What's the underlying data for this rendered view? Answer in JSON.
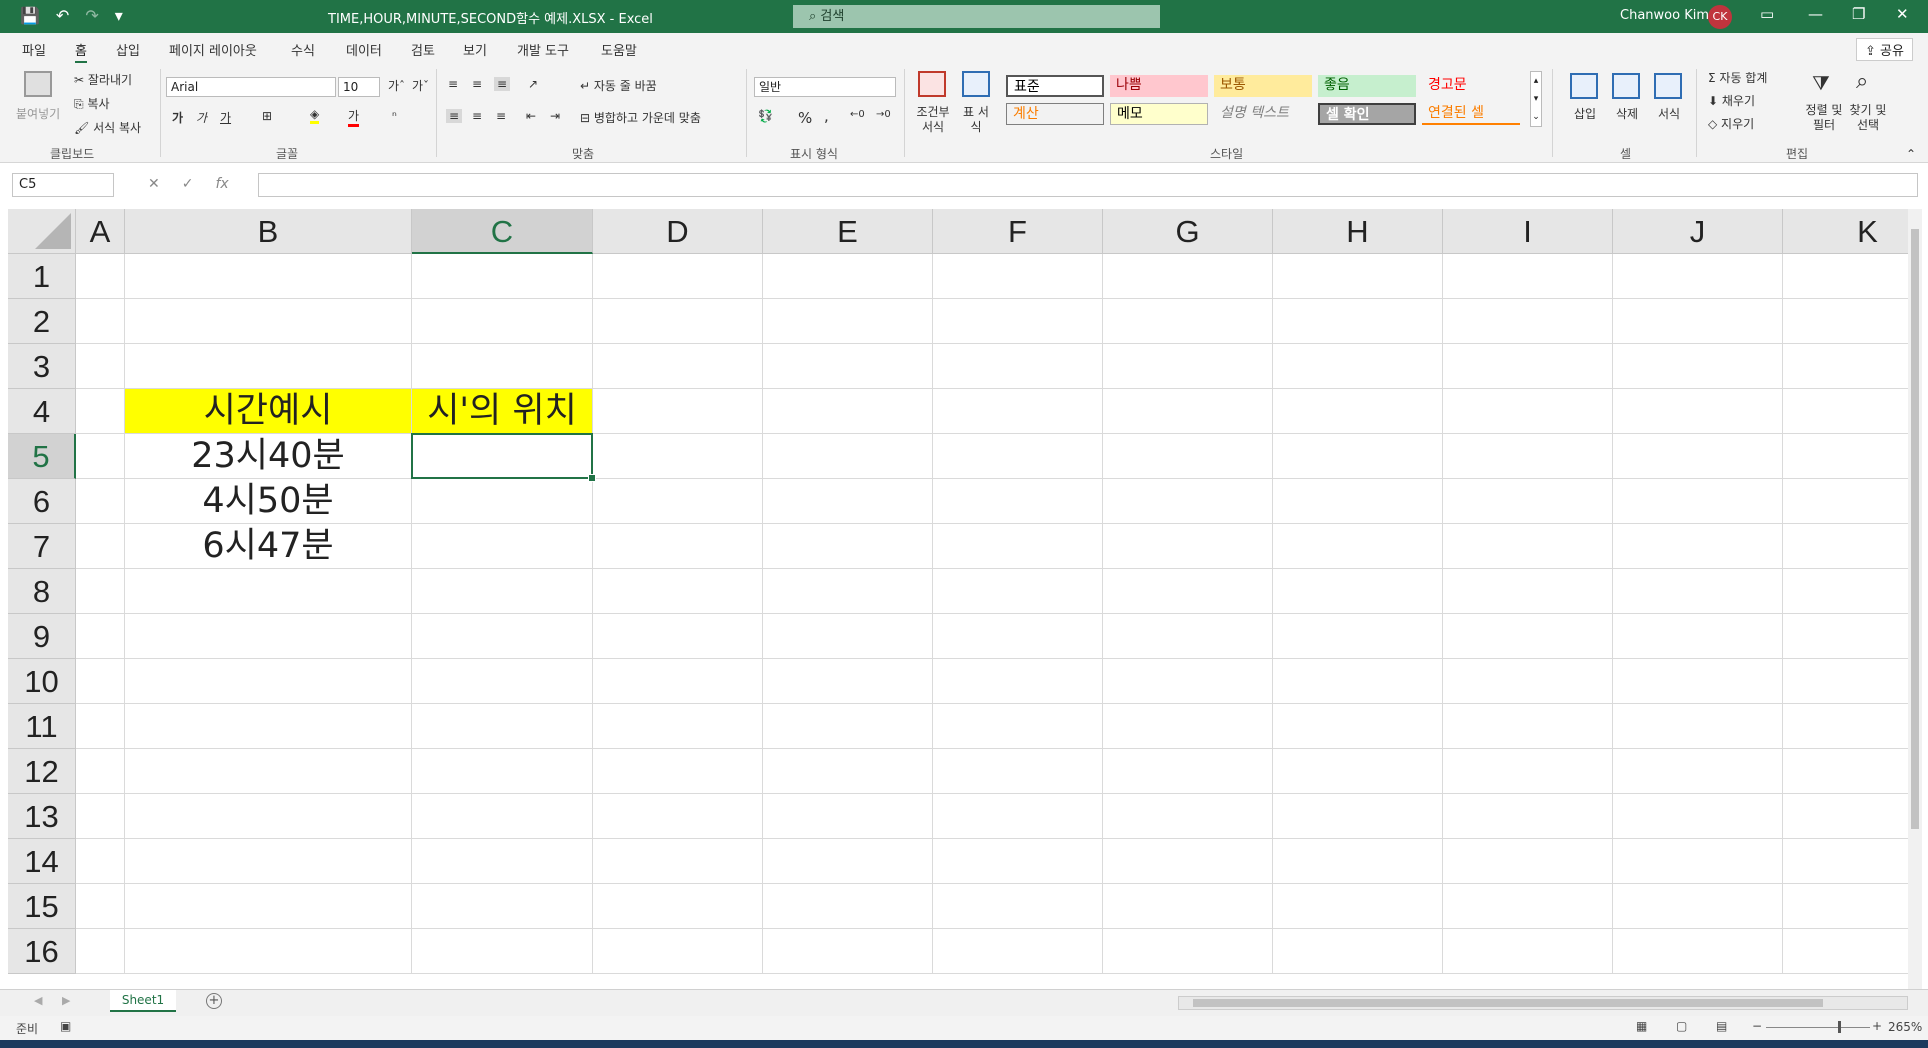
{
  "titlebar": {
    "doc_title": "TIME,HOUR,MINUTE,SECOND함수 예제.XLSX  -  Excel",
    "search_placeholder": "검색",
    "user_name": "Chanwoo Kim",
    "user_initials": "CK",
    "save_icon": "save-icon",
    "undo_icon": "undo-icon",
    "redo_icon": "redo-icon"
  },
  "menu": {
    "tabs": [
      "파일",
      "홈",
      "삽입",
      "페이지 레이아웃",
      "수식",
      "데이터",
      "검토",
      "보기",
      "개발 도구",
      "도움말"
    ],
    "active_tab": "홈",
    "share_label": "공유"
  },
  "ribbon": {
    "clipboard": {
      "paste": "붙여넣기",
      "cut": "잘라내기",
      "copy": "복사",
      "format_painter": "서식 복사",
      "label": "클립보드"
    },
    "font": {
      "family": "Arial",
      "size": "10",
      "bold": "가",
      "italic": "가",
      "underline": "가",
      "label": "글꼴"
    },
    "alignment": {
      "wrap": "자동 줄 바꿈",
      "merge": "병합하고 가운데 맞춤",
      "label": "맞춤"
    },
    "number": {
      "format": "일반",
      "percent": "%",
      "comma": ",",
      "label": "표시 형식"
    },
    "styles": {
      "conditional": "조건부 서식",
      "table": "표 서식",
      "cells": [
        {
          "name": "표준",
          "bg": "#ffffff",
          "fg": "#000000"
        },
        {
          "name": "나쁨",
          "bg": "#ffc7ce",
          "fg": "#9c0006"
        },
        {
          "name": "보통",
          "bg": "#ffeb9c",
          "fg": "#9c5700"
        },
        {
          "name": "좋음",
          "bg": "#c6efce",
          "fg": "#006100"
        },
        {
          "name": "경고문",
          "bg": "#f3f3f3",
          "fg": "#ff0000"
        },
        {
          "name": "계산",
          "bg": "#f2f2f2",
          "fg": "#fa7d00"
        },
        {
          "name": "메모",
          "bg": "#ffffcc",
          "fg": "#000000"
        },
        {
          "name": "설명 텍스트",
          "bg": "#f3f3f3",
          "fg": "#7f7f7f"
        },
        {
          "name": "셀 확인",
          "bg": "#a5a5a5",
          "fg": "#ffffff"
        },
        {
          "name": "연결된 셀",
          "bg": "#f3f3f3",
          "fg": "#fa7d00"
        }
      ],
      "label": "스타일"
    },
    "cells_group": {
      "insert": "삽입",
      "delete": "삭제",
      "format": "서식",
      "label": "셀"
    },
    "editing": {
      "autosum": "자동 합계",
      "fill": "채우기",
      "clear": "지우기",
      "sort_filter": "정렬 및 필터",
      "find_select": "찾기 및 선택",
      "label": "편집"
    }
  },
  "formula_bar": {
    "name_box": "C5",
    "cancel": "✕",
    "enter": "✓",
    "fx": "fx",
    "formula": ""
  },
  "grid": {
    "columns": [
      "A",
      "B",
      "C",
      "D",
      "E",
      "F",
      "G",
      "H",
      "I",
      "J",
      "K"
    ],
    "rows": [
      "1",
      "2",
      "3",
      "4",
      "5",
      "6",
      "7",
      "8",
      "9",
      "10",
      "11",
      "12",
      "13",
      "14",
      "15",
      "16"
    ],
    "selected_column": "C",
    "selected_row": "5",
    "cells": {
      "B4": "시간예시",
      "C4": "시'의 위치",
      "B5": "23시40분",
      "B6": "4시50분",
      "B7": "6시47분"
    },
    "highlight_color": "#ffff00"
  },
  "sheets": {
    "tabs": [
      "Sheet1"
    ],
    "active": "Sheet1"
  },
  "status": {
    "ready": "준비",
    "zoom": "265%"
  }
}
